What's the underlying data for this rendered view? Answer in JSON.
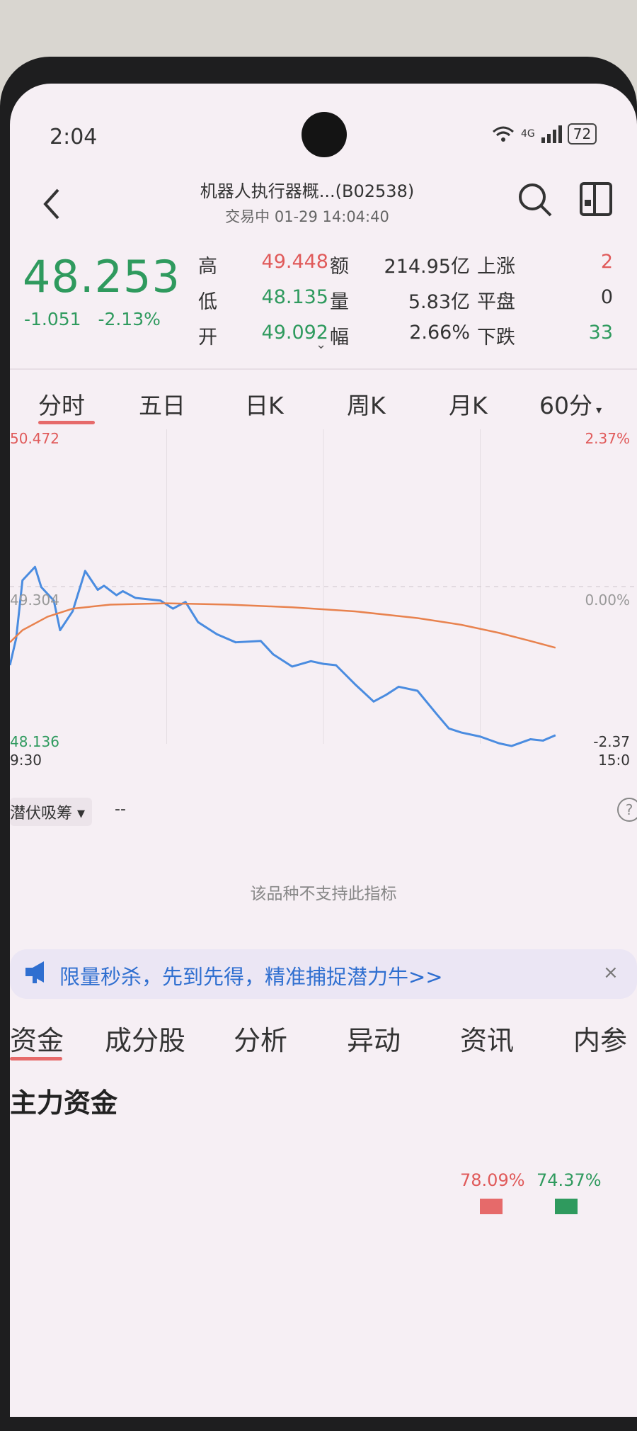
{
  "status_bar": {
    "time": "2:04",
    "network": "4G",
    "battery": "72"
  },
  "header": {
    "title": "机器人执行器概...(B02538)",
    "subtitle": "交易中 01-29 14:04:40"
  },
  "quote": {
    "price": "48.253",
    "change": "-1.051",
    "change_pct": "-2.13%",
    "stats": {
      "high_label": "高",
      "high": "49.448",
      "low_label": "低",
      "low": "48.135",
      "open_label": "开",
      "open": "49.092",
      "amount_label": "额",
      "amount": "214.95亿",
      "volume_label": "量",
      "volume": "5.83亿",
      "range_label": "幅",
      "range": "2.66%",
      "up_label": "上涨",
      "up": "2",
      "flat_label": "平盘",
      "flat": "0",
      "down_label": "下跌",
      "down": "33"
    }
  },
  "tabs": [
    "分时",
    "五日",
    "日K",
    "周K",
    "月K",
    "60分"
  ],
  "active_tab": "分时",
  "chart": {
    "top_price": "50.472",
    "top_pct": "2.37%",
    "mid_price": "49.304",
    "mid_pct": "0.00%",
    "bottom_price": "48.136",
    "bottom_pct": "-2.37",
    "start_time": "9:30",
    "end_time": "15:0"
  },
  "chart_data": {
    "type": "line",
    "x_range": [
      "9:30",
      "15:00"
    ],
    "ylim": [
      48.136,
      50.472
    ],
    "series": [
      {
        "color": "#4a8ce0",
        "x": [
          0,
          0.01,
          0.02,
          0.04,
          0.05,
          0.07,
          0.08,
          0.1,
          0.12,
          0.14,
          0.15,
          0.17,
          0.18,
          0.2,
          0.22,
          0.24,
          0.26,
          0.28,
          0.3,
          0.33,
          0.36,
          0.4,
          0.42,
          0.45,
          0.48,
          0.5,
          0.52,
          0.55,
          0.58,
          0.6,
          0.62,
          0.65,
          0.68,
          0.7,
          0.72,
          0.75,
          0.78,
          0.8,
          0.83,
          0.85,
          0.87
        ],
        "values": [
          48.72,
          48.92,
          49.35,
          49.45,
          49.3,
          49.2,
          48.98,
          49.12,
          49.42,
          49.28,
          49.31,
          49.24,
          49.27,
          49.22,
          49.21,
          49.2,
          49.14,
          49.19,
          49.04,
          48.95,
          48.89,
          48.9,
          48.8,
          48.71,
          48.75,
          48.73,
          48.72,
          48.58,
          48.45,
          48.5,
          48.56,
          48.53,
          48.36,
          48.25,
          48.22,
          48.19,
          48.14,
          48.12,
          48.17,
          48.16,
          48.2
        ]
      },
      {
        "color": "#e8824e",
        "x": [
          0,
          0.02,
          0.06,
          0.1,
          0.16,
          0.25,
          0.35,
          0.45,
          0.55,
          0.65,
          0.72,
          0.78,
          0.83,
          0.87
        ],
        "values": [
          48.89,
          48.98,
          49.08,
          49.14,
          49.17,
          49.18,
          49.17,
          49.15,
          49.12,
          49.07,
          49.02,
          48.96,
          48.9,
          48.85
        ]
      }
    ]
  },
  "indicator": {
    "name": "潜伏吸筹 ▾",
    "value": "--",
    "message": "该品种不支持此指标"
  },
  "banner": {
    "text": "限量秒杀，先到先得，精准捕捉潜力牛>>",
    "close": "×"
  },
  "bottom_tabs": [
    "资金",
    "成分股",
    "分析",
    "异动",
    "资讯",
    "内参"
  ],
  "funds": {
    "title": "主力资金",
    "pct_in": "78.09%",
    "pct_out": "74.37%"
  },
  "colors": {
    "up": "#e05a5a",
    "down": "#2f9a5e",
    "accent_line": "#4a8ce0",
    "avg_line": "#e8824e",
    "tab_active": "#e66a6a"
  }
}
